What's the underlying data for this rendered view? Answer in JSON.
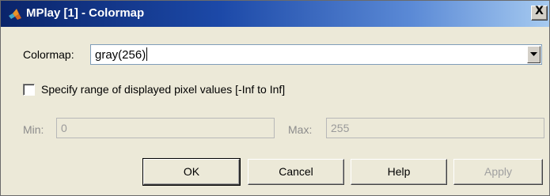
{
  "window": {
    "title": "MPlay [1] - Colormap",
    "close_glyph": "X",
    "icon": "matlab-logo-icon"
  },
  "colormap": {
    "label": "Colormap:",
    "value": "gray(256)"
  },
  "range_checkbox": {
    "label": "Specify range of displayed pixel values [-Inf to Inf]",
    "checked": false
  },
  "min": {
    "label": "Min:",
    "value": "0",
    "enabled": false
  },
  "max": {
    "label": "Max:",
    "value": "255",
    "enabled": false
  },
  "buttons": {
    "ok": "OK",
    "cancel": "Cancel",
    "help": "Help",
    "apply": "Apply"
  }
}
